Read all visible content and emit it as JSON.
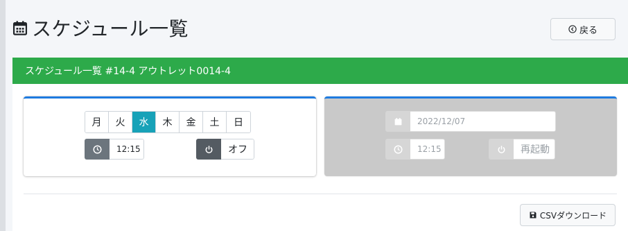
{
  "page": {
    "title": "スケジュール一覧",
    "back_label": "戻る"
  },
  "banner": {
    "text": "スケジュール一覧 #14-4 アウトレット0014-4"
  },
  "weekly": {
    "days": [
      "月",
      "火",
      "水",
      "木",
      "金",
      "土",
      "日"
    ],
    "selected_day": "水",
    "time": "12:15",
    "power_label": "オフ"
  },
  "oneshot": {
    "date": "2022/12/07",
    "time": "12:15",
    "action_label": "再起動"
  },
  "footer": {
    "csv_label": "CSVダウンロード"
  },
  "icons": {
    "title": "calendar-icon",
    "back": "circle-arrow-left-icon",
    "clock": "clock-icon",
    "power": "power-icon",
    "date": "calendar-icon",
    "csv": "save-icon"
  },
  "colors": {
    "banner": "#2daa4a",
    "active_day": "#17a2b8",
    "addon": "#6c757d",
    "card_border": "#1e7be0",
    "disabled_card": "#c9c9c9"
  }
}
